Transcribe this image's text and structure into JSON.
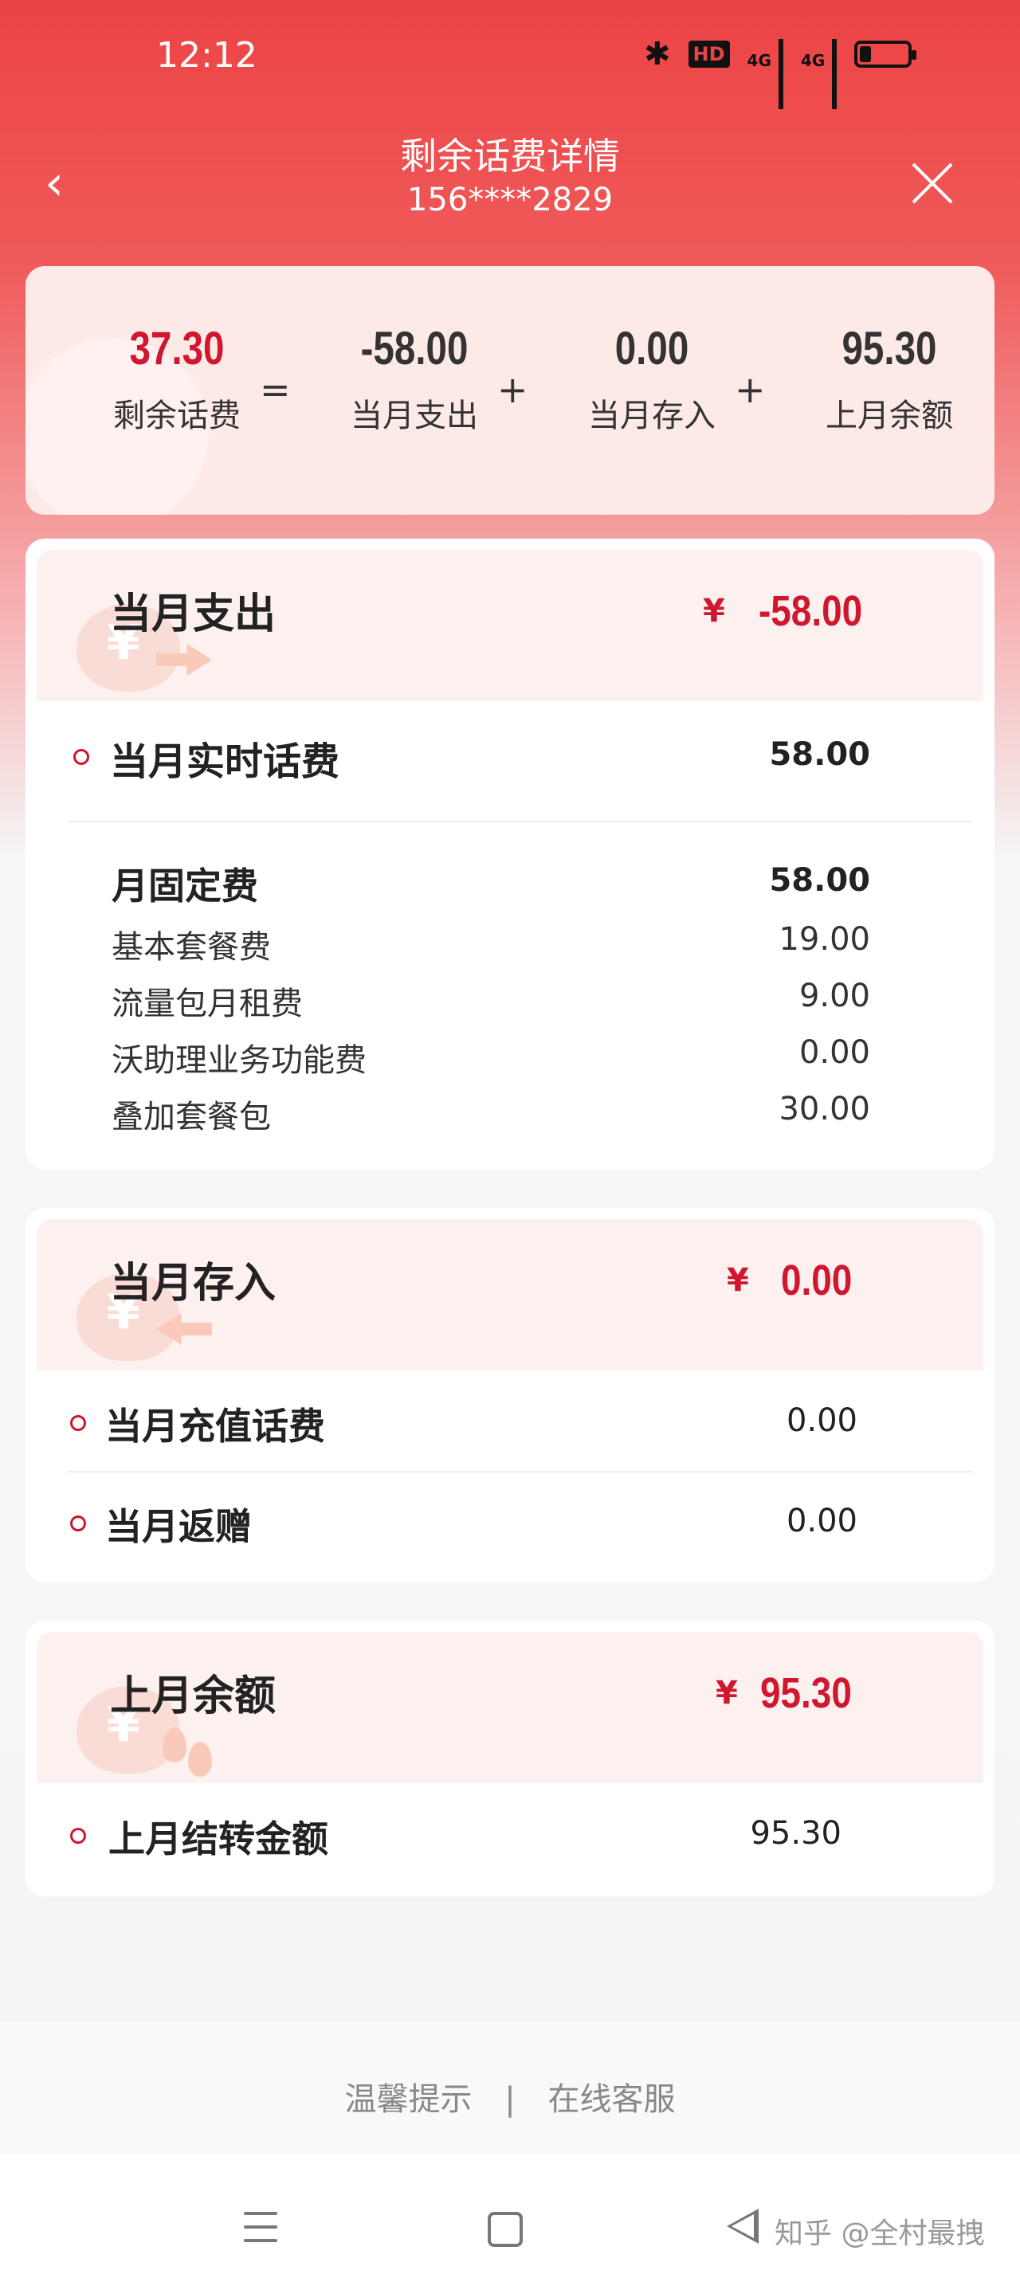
{
  "status_bar": {
    "time": "12:12",
    "hd_label": "HD",
    "signal1": "4G",
    "signal2": "4G"
  },
  "header": {
    "title": "剩余话费详情",
    "phone": "156****2829"
  },
  "summary": {
    "items": [
      {
        "value": "37.30",
        "label": "剩余话费"
      },
      {
        "value": "-58.00",
        "label": "当月支出"
      },
      {
        "value": "0.00",
        "label": "当月存入"
      },
      {
        "value": "95.30",
        "label": "上月余额"
      }
    ],
    "ops": [
      "=",
      "+",
      "+"
    ]
  },
  "expense": {
    "title": "当月支出",
    "currency": "¥",
    "amount": "-58.00",
    "realtime_label": "当月实时话费",
    "realtime_value": "58.00",
    "fixed_label": "月固定费",
    "fixed_value": "58.00",
    "items": [
      {
        "label": "基本套餐费",
        "value": "19.00"
      },
      {
        "label": "流量包月租费",
        "value": "9.00"
      },
      {
        "label": "沃助理业务功能费",
        "value": "0.00"
      },
      {
        "label": "叠加套餐包",
        "value": "30.00"
      }
    ]
  },
  "deposit": {
    "title": "当月存入",
    "currency": "¥",
    "amount": "0.00",
    "rows": [
      {
        "label": "当月充值话费",
        "value": "0.00"
      },
      {
        "label": "当月返赠",
        "value": "0.00"
      }
    ]
  },
  "last_month": {
    "title": "上月余额",
    "currency": "¥",
    "amount": "95.30",
    "rows": [
      {
        "label": "上月结转金额",
        "value": "95.30"
      }
    ]
  },
  "footer": {
    "tip": "温馨提示",
    "separator": "|",
    "service": "在线客服"
  },
  "watermark": "知乎 @全村最拽",
  "colors": {
    "brand_red": "#ec4345",
    "amount_red": "#d1162f"
  }
}
